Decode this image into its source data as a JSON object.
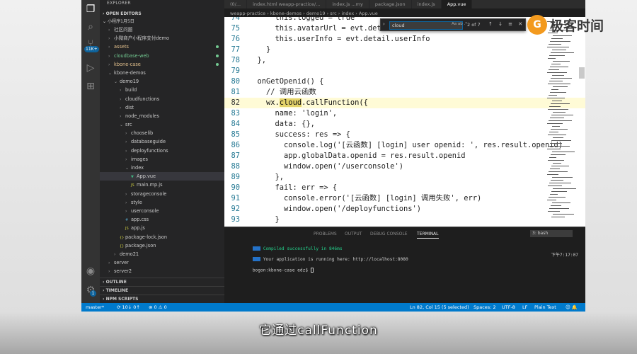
{
  "window": {
    "tabs": [
      "(0/...",
      "index.html  weapp-practice/...",
      "index.js  ...my",
      "package.json",
      "index.js",
      "App.vue"
    ],
    "active_tab_index": 5,
    "breadcrumb": "weapp-practice  ›  kbone-demos  ›  demo19  ›  src  ›  index  ›  App.vue"
  },
  "explorer": {
    "title": "EXPLORER",
    "open_editors": "OPEN EDITORS",
    "project": "小程序1月5日",
    "items": [
      {
        "label": "社区问题",
        "indent": 1,
        "chev": "›",
        "style": ""
      },
      {
        "label": "小微商户小程序支付demo",
        "indent": 1,
        "chev": "›",
        "style": ""
      },
      {
        "label": "assets",
        "indent": 1,
        "chev": "›",
        "style": "mod",
        "dot": true
      },
      {
        "label": "cloudbase-web",
        "indent": 1,
        "chev": "›",
        "style": "add",
        "dot": true
      },
      {
        "label": "kbone-case",
        "indent": 1,
        "chev": "›",
        "style": "mod",
        "dot": true
      },
      {
        "label": "kbone-demos",
        "indent": 1,
        "chev": "⌄",
        "style": ""
      },
      {
        "label": "demo19",
        "indent": 2,
        "chev": "⌄",
        "style": ""
      },
      {
        "label": "build",
        "indent": 3,
        "chev": "›",
        "style": ""
      },
      {
        "label": "cloudfunctions",
        "indent": 3,
        "chev": "›",
        "style": ""
      },
      {
        "label": "dist",
        "indent": 3,
        "chev": "›",
        "style": ""
      },
      {
        "label": "node_modules",
        "indent": 3,
        "chev": "›",
        "style": ""
      },
      {
        "label": "src",
        "indent": 3,
        "chev": "⌄",
        "style": ""
      },
      {
        "label": "chooselib",
        "indent": 4,
        "chev": "›",
        "style": ""
      },
      {
        "label": "databaseguide",
        "indent": 4,
        "chev": "›",
        "style": ""
      },
      {
        "label": "deployfunctions",
        "indent": 4,
        "chev": "›",
        "style": ""
      },
      {
        "label": "images",
        "indent": 4,
        "chev": "›",
        "style": ""
      },
      {
        "label": "index",
        "indent": 4,
        "chev": "⌄",
        "style": ""
      },
      {
        "label": "App.vue",
        "indent": 5,
        "chev": "",
        "style": "sel",
        "icon": "V"
      },
      {
        "label": "main.mp.js",
        "indent": 5,
        "chev": "",
        "style": "",
        "icon": "JS"
      },
      {
        "label": "storageconsole",
        "indent": 4,
        "chev": "›",
        "style": ""
      },
      {
        "label": "style",
        "indent": 4,
        "chev": "›",
        "style": ""
      },
      {
        "label": "userconsole",
        "indent": 4,
        "chev": "›",
        "style": ""
      },
      {
        "label": "app.css",
        "indent": 4,
        "chev": "",
        "style": "",
        "icon": "#"
      },
      {
        "label": "app.js",
        "indent": 4,
        "chev": "",
        "style": "",
        "icon": "JS"
      },
      {
        "label": "package-lock.json",
        "indent": 3,
        "chev": "",
        "style": "",
        "icon": "{}"
      },
      {
        "label": "package.json",
        "indent": 3,
        "chev": "",
        "style": "",
        "icon": "{}"
      },
      {
        "label": "demo21",
        "indent": 2,
        "chev": "›",
        "style": ""
      },
      {
        "label": "server",
        "indent": 1,
        "chev": "›",
        "style": ""
      },
      {
        "label": "server2",
        "indent": 1,
        "chev": "›",
        "style": ""
      }
    ],
    "outline": "OUTLINE",
    "timeline": "TIMELINE",
    "npm_scripts": "NPM SCRIPTS"
  },
  "activity_badge": "11K+",
  "activity_badge2": "1",
  "editor": {
    "lines": [
      {
        "n": "74",
        "code": "      this.logged = true"
      },
      {
        "n": "75",
        "code": "      this.avatarUrl = evt.detail.userInfo.avatarUrl"
      },
      {
        "n": "76",
        "code": "      this.userInfo = evt.detail.userInfo"
      },
      {
        "n": "77",
        "code": "    }"
      },
      {
        "n": "78",
        "code": "  },"
      },
      {
        "n": "79",
        "code": ""
      },
      {
        "n": "80",
        "code": "  onGetOpenid() {"
      },
      {
        "n": "81",
        "code": "    // 调用云函数"
      },
      {
        "n": "82",
        "code": "    wx.cloud.callFunction({",
        "highlight": true
      },
      {
        "n": "83",
        "code": "      name: 'login',"
      },
      {
        "n": "84",
        "code": "      data: {},"
      },
      {
        "n": "85",
        "code": "      success: res => {"
      },
      {
        "n": "86",
        "code": "        console.log('[云函数] [login] user openid: ', res.result.openid)"
      },
      {
        "n": "87",
        "code": "        app.globalData.openid = res.result.openid"
      },
      {
        "n": "88",
        "code": "        window.open('/userconsole')"
      },
      {
        "n": "89",
        "code": "      },"
      },
      {
        "n": "90",
        "code": "      fail: err => {"
      },
      {
        "n": "91",
        "code": "        console.error('[云函数] [login] 调用失败', err)"
      },
      {
        "n": "92",
        "code": "        window.open('/deployfunctions')"
      },
      {
        "n": "93",
        "code": "      }"
      }
    ]
  },
  "find_widget": {
    "value": "cloud",
    "options": "Aa ab .*",
    "count": "2 of 7",
    "buttons": "↑ ↓ ≡ ✕"
  },
  "panel": {
    "tabs": [
      "PROBLEMS",
      "OUTPUT",
      "DEBUG CONSOLE",
      "TERMINAL"
    ],
    "active": 3,
    "terminal_select": "3: bash",
    "timestamp": "下午7:17:07",
    "lines": {
      "compiled": "Compiled successfully in 846ms",
      "running": "Your application is running here: http://localhost:8080",
      "prompt": "bogon:kbone-case edz$ "
    }
  },
  "statusbar": {
    "branch": "master*",
    "sync": "⟳ 10↓ 0↑",
    "errors": "⊗ 0 ⚠ 0",
    "position": "Ln 82, Col 15 (5 selected)",
    "spaces": "Spaces: 2",
    "encoding": "UTF-8",
    "eol": "LF",
    "language": "Plain Text",
    "icons": "☺ 🔔"
  },
  "logo": {
    "mark": "G",
    "text": "极客时间"
  },
  "subtitle": "它通过callFunction"
}
